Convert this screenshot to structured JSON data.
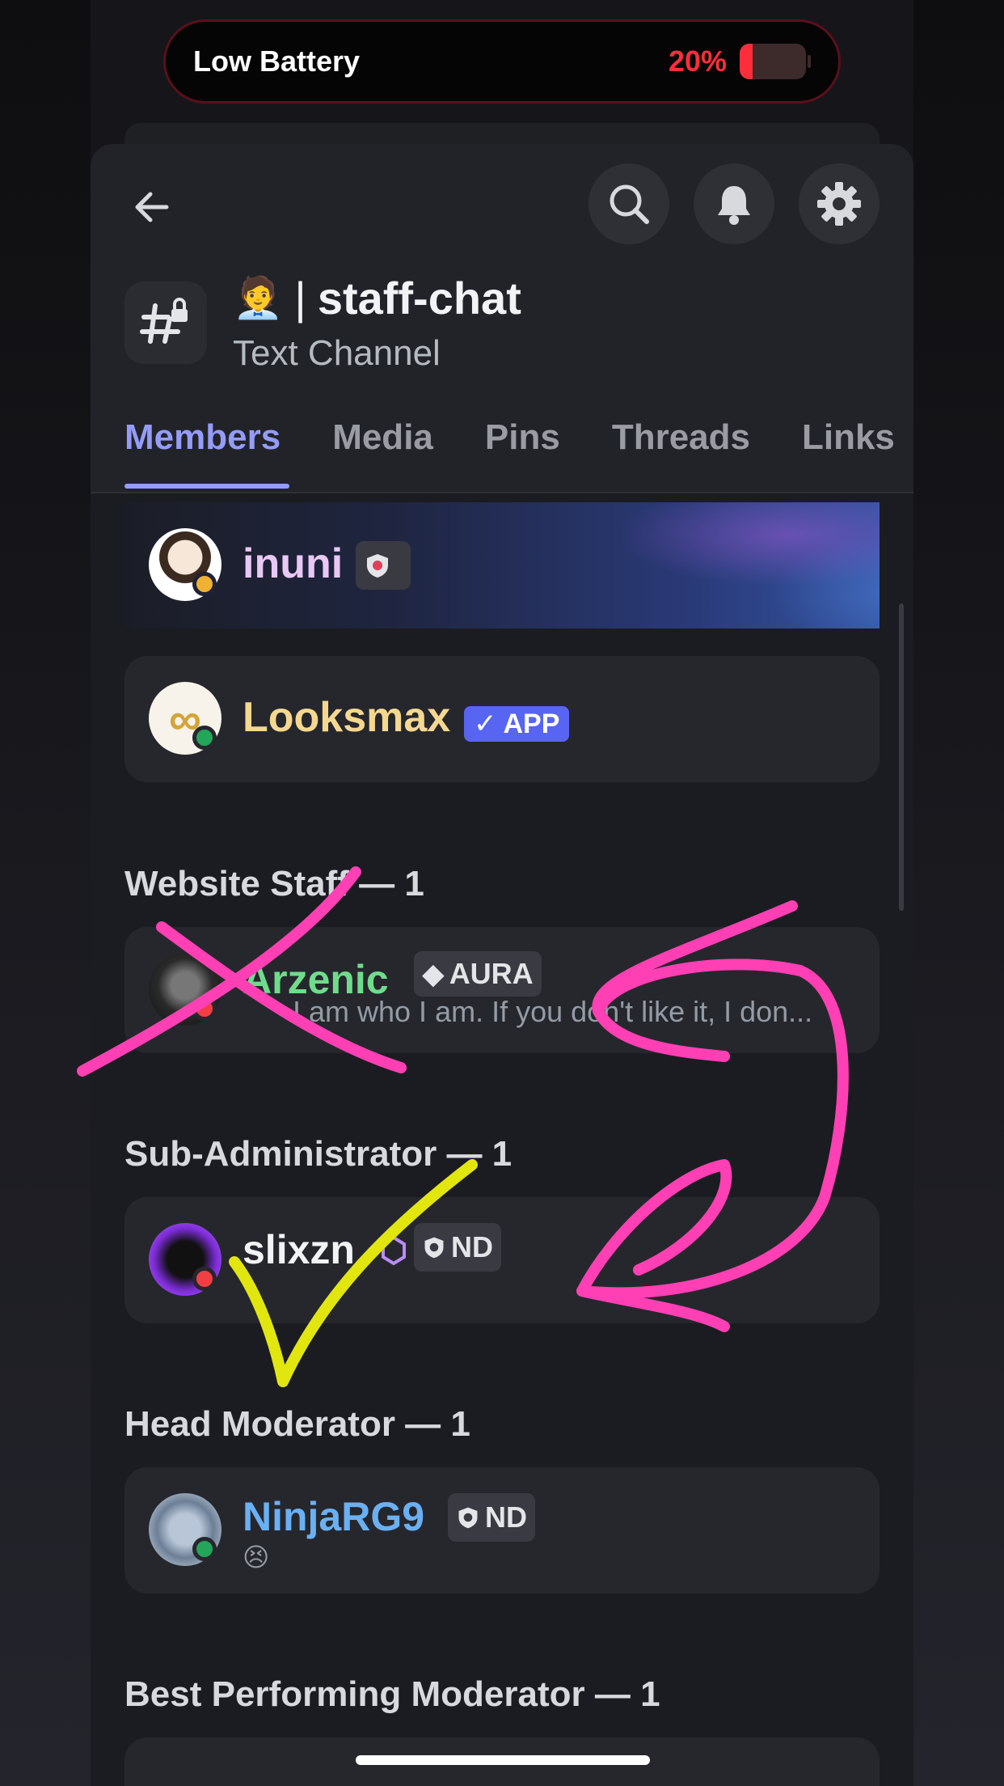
{
  "battery": {
    "label": "Low Battery",
    "percent": "20%",
    "level": 0.2,
    "color": "#ff2d3a"
  },
  "header": {
    "channel_emoji": "🧑‍💼",
    "channel_separator": "|",
    "channel_name": "staff-chat",
    "channel_type": "Text Channel",
    "buttons": [
      "back-icon",
      "search-icon",
      "bell-icon",
      "gear-icon"
    ]
  },
  "tabs": [
    {
      "label": "Members",
      "active": true
    },
    {
      "label": "Media",
      "active": false
    },
    {
      "label": "Pins",
      "active": false
    },
    {
      "label": "Threads",
      "active": false
    },
    {
      "label": "Links",
      "active": false
    }
  ],
  "members_top": [
    {
      "name": "inuni",
      "name_color": "#e9c8f5",
      "status": "idle",
      "has_tag_icon": true
    },
    {
      "name": "Looksmax",
      "name_color": "#f5d890",
      "status": "online",
      "badge": "APP"
    }
  ],
  "sections": [
    {
      "title": "Website Staff — 1",
      "member": {
        "name": "Arzenic",
        "name_color": "#6fdc8c",
        "tag": "AURA",
        "status": "dnd",
        "custom_status": "I am who I am. If you don't like it, I don..."
      }
    },
    {
      "title": "Sub-Administrator — 1",
      "member": {
        "name": "slixzn",
        "name_color": "#f2f3f5",
        "tag": "ND",
        "status": "dnd"
      }
    },
    {
      "title": "Head Moderator — 1",
      "member": {
        "name": "NinjaRG9",
        "name_color": "#6ab0f3",
        "tag": "ND",
        "status": "online",
        "status_emoji": "😣"
      }
    },
    {
      "title": "Best Performing Moderator — 1"
    }
  ],
  "colors": {
    "accent": "#949cf7",
    "online": "#23a55a",
    "dnd": "#f23f43",
    "idle": "#f0b232",
    "annotation_pink": "#ff3fb4",
    "annotation_yellow": "#e2e60f"
  }
}
